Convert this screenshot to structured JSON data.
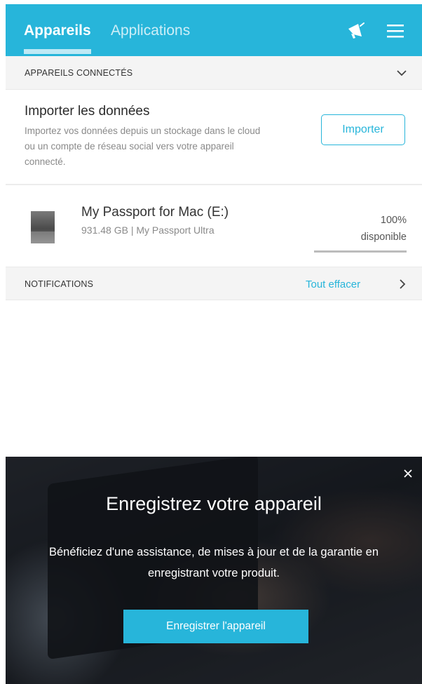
{
  "header": {
    "tabs": [
      {
        "label": "Appareils",
        "active": true
      },
      {
        "label": "Applications",
        "active": false
      }
    ],
    "icons": [
      "megaphone-icon",
      "menu-icon"
    ],
    "accent": "#27b5da"
  },
  "connected": {
    "label": "APPAREILS CONNECTÉS",
    "toggle_icon": "chevron-down-icon"
  },
  "import": {
    "title": "Importer les données",
    "description": "Importez vos données depuis un stockage dans le cloud ou un compte de réseau social vers votre appareil connecté.",
    "button": "Importer"
  },
  "device": {
    "name": "My Passport for Mac (E:)",
    "info": "931.48 GB | My Passport Ultra",
    "percent": "100%",
    "available": "disponible",
    "progress_fraction": 1.0,
    "icon": "hard-drive-icon"
  },
  "notifications": {
    "label": "NOTIFICATIONS",
    "clear": "Tout effacer",
    "icon": "chevron-right-icon"
  },
  "banner": {
    "title": "Enregistrez votre appareil",
    "text": "Bénéficiez d'une assistance, de mises à jour et de la garantie en enregistrant votre produit.",
    "button": "Enregistrer l'appareil",
    "close_icon": "close-icon"
  }
}
